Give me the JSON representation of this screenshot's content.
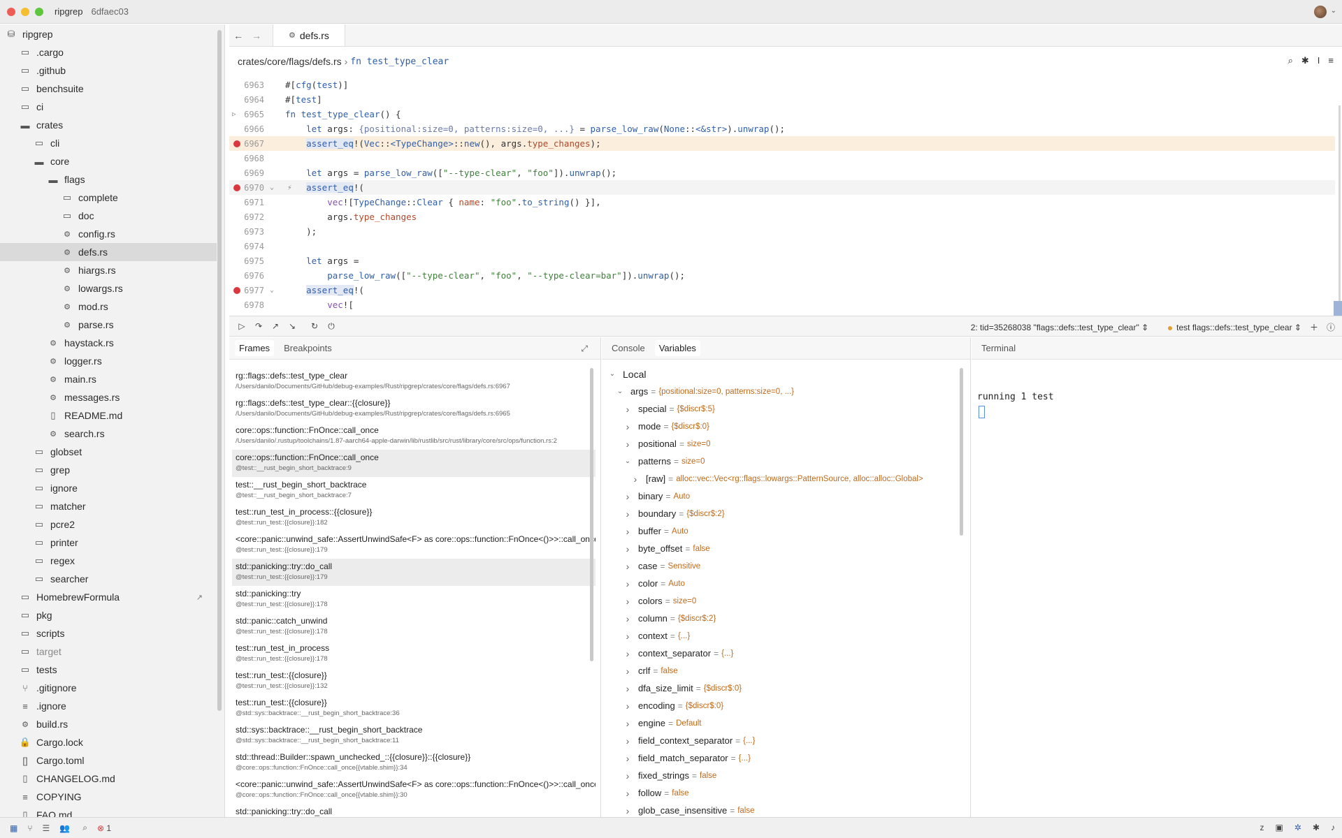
{
  "window": {
    "project": "ripgrep",
    "commit": "6dfaec03"
  },
  "colors": {
    "accent": "#2f5ea8",
    "breakpoint": "#d9393e",
    "value": "#c06a1c",
    "string": "#3f7f3a"
  },
  "sidebar": {
    "items": [
      {
        "label": "ripgrep",
        "icon": "repo-icon",
        "indent": 0
      },
      {
        "label": ".cargo",
        "icon": "folder-icon",
        "indent": 1
      },
      {
        "label": ".github",
        "icon": "folder-icon",
        "indent": 1
      },
      {
        "label": "benchsuite",
        "icon": "folder-icon",
        "indent": 1
      },
      {
        "label": "ci",
        "icon": "folder-icon",
        "indent": 1
      },
      {
        "label": "crates",
        "icon": "folder-open-icon",
        "indent": 1
      },
      {
        "label": "cli",
        "icon": "folder-icon",
        "indent": 2
      },
      {
        "label": "core",
        "icon": "folder-open-icon",
        "indent": 2
      },
      {
        "label": "flags",
        "icon": "folder-open-icon",
        "indent": 3
      },
      {
        "label": "complete",
        "icon": "folder-icon",
        "indent": 4
      },
      {
        "label": "doc",
        "icon": "folder-icon",
        "indent": 4
      },
      {
        "label": "config.rs",
        "icon": "rust-file-icon",
        "indent": 4
      },
      {
        "label": "defs.rs",
        "icon": "rust-file-icon",
        "indent": 4,
        "selected": true
      },
      {
        "label": "hiargs.rs",
        "icon": "rust-file-icon",
        "indent": 4
      },
      {
        "label": "lowargs.rs",
        "icon": "rust-file-icon",
        "indent": 4
      },
      {
        "label": "mod.rs",
        "icon": "rust-file-icon",
        "indent": 4
      },
      {
        "label": "parse.rs",
        "icon": "rust-file-icon",
        "indent": 4
      },
      {
        "label": "haystack.rs",
        "icon": "rust-file-icon",
        "indent": 3
      },
      {
        "label": "logger.rs",
        "icon": "rust-file-icon",
        "indent": 3
      },
      {
        "label": "main.rs",
        "icon": "rust-file-icon",
        "indent": 3
      },
      {
        "label": "messages.rs",
        "icon": "rust-file-icon",
        "indent": 3
      },
      {
        "label": "README.md",
        "icon": "book-icon",
        "indent": 3
      },
      {
        "label": "search.rs",
        "icon": "rust-file-icon",
        "indent": 3
      },
      {
        "label": "globset",
        "icon": "folder-icon",
        "indent": 2
      },
      {
        "label": "grep",
        "icon": "folder-icon",
        "indent": 2
      },
      {
        "label": "ignore",
        "icon": "folder-icon",
        "indent": 2
      },
      {
        "label": "matcher",
        "icon": "folder-icon",
        "indent": 2
      },
      {
        "label": "pcre2",
        "icon": "folder-icon",
        "indent": 2
      },
      {
        "label": "printer",
        "icon": "folder-icon",
        "indent": 2
      },
      {
        "label": "regex",
        "icon": "folder-icon",
        "indent": 2
      },
      {
        "label": "searcher",
        "icon": "folder-icon",
        "indent": 2
      },
      {
        "label": "HomebrewFormula",
        "icon": "folder-icon",
        "indent": 1,
        "ext": true
      },
      {
        "label": "pkg",
        "icon": "folder-icon",
        "indent": 1
      },
      {
        "label": "scripts",
        "icon": "folder-icon",
        "indent": 1
      },
      {
        "label": "target",
        "icon": "folder-icon",
        "indent": 1,
        "muted": true
      },
      {
        "label": "tests",
        "icon": "folder-icon",
        "indent": 1
      },
      {
        "label": ".gitignore",
        "icon": "git-icon",
        "indent": 1
      },
      {
        "label": ".ignore",
        "icon": "lines-icon",
        "indent": 1
      },
      {
        "label": "build.rs",
        "icon": "rust-file-icon",
        "indent": 1
      },
      {
        "label": "Cargo.lock",
        "icon": "lock-icon",
        "indent": 1
      },
      {
        "label": "Cargo.toml",
        "icon": "toml-icon",
        "indent": 1
      },
      {
        "label": "CHANGELOG.md",
        "icon": "file-icon",
        "indent": 1
      },
      {
        "label": "COPYING",
        "icon": "lines-icon",
        "indent": 1
      },
      {
        "label": "FAQ.md",
        "icon": "file-icon",
        "indent": 1
      }
    ]
  },
  "editor": {
    "tab": "defs.rs",
    "breadcrumb_path": "crates/core/flags/defs.rs",
    "breadcrumb_sep": "›",
    "breadcrumb_fn": "fn test_type_clear",
    "lines": [
      {
        "n": "6963",
        "html": "#[<span class='kw'>cfg</span>(<span class='kw'>test</span>)]"
      },
      {
        "n": "6964",
        "html": "#[<span class='kw'>test</span>]"
      },
      {
        "n": "6965",
        "html": "<span class='kw'>fn</span> <span class='kw'>test_type_clear</span>() {",
        "run": true
      },
      {
        "n": "6966",
        "html": "    <span class='kw'>let</span> args: <span class='inl'>{positional:size=0, patterns:size=0, ...}</span> = <span class='kw'>parse_low_raw</span>(<span class='kw'>None</span>::<span class='kw'>&lt;&amp;str&gt;</span>).<span class='kw'>unwrap</span>();"
      },
      {
        "n": "6967",
        "html": "    <span class='mc am'>assert_eq</span>!(<span class='kw'>Vec</span>::<span class='kw'>&lt;TypeChange&gt;</span>::<span class='kw'>new</span>(), args.<span class='fld'>type_changes</span>);",
        "bp": true,
        "hl": true
      },
      {
        "n": "6968",
        "html": ""
      },
      {
        "n": "6969",
        "html": "    <span class='kw'>let</span> args = <span class='kw'>parse_low_raw</span>([<span class='st'>\"--type-clear\"</span>, <span class='st'>\"foo\"</span>]).<span class='kw'>unwrap</span>();"
      },
      {
        "n": "6970",
        "html": "    <span class='mc am'>assert_eq</span>!(",
        "bp": true,
        "fold": true,
        "bolt": true,
        "hl2": true
      },
      {
        "n": "6971",
        "html": "        <span class='mc'>vec</span>![<span class='kw'>TypeChange</span>::<span class='kw'>Clear</span> { <span class='fld'>name</span>: <span class='st'>\"foo\"</span>.<span class='kw'>to_string</span>() }],"
      },
      {
        "n": "6972",
        "html": "        args.<span class='fld'>type_changes</span>"
      },
      {
        "n": "6973",
        "html": "    );"
      },
      {
        "n": "6974",
        "html": ""
      },
      {
        "n": "6975",
        "html": "    <span class='kw'>let</span> args ="
      },
      {
        "n": "6976",
        "html": "        <span class='kw'>parse_low_raw</span>([<span class='st'>\"--type-clear\"</span>, <span class='st'>\"foo\"</span>, <span class='st'>\"--type-clear=bar\"</span>]).<span class='kw'>unwrap</span>();"
      },
      {
        "n": "6977",
        "html": "    <span class='mc am'>assert_eq</span>!(",
        "bp": true,
        "fold": true
      },
      {
        "n": "6978",
        "html": "        <span class='mc'>vec</span>!["
      }
    ]
  },
  "debug": {
    "thread": "2: tid=35268038 \"flags::defs::test_type_clear\"",
    "session": "test flags::defs::test_type_clear"
  },
  "frames_panel": {
    "tabs": [
      "Frames",
      "Breakpoints"
    ],
    "frames": [
      {
        "name": "rg::flags::defs::test_type_clear",
        "path": "/Users/danilo/Documents/GitHub/debug-examples/Rust/ripgrep/crates/core/flags/defs.rs:6967"
      },
      {
        "name": "rg::flags::defs::test_type_clear::{{closure}}",
        "path": "/Users/danilo/Documents/GitHub/debug-examples/Rust/ripgrep/crates/core/flags/defs.rs:6965"
      },
      {
        "name": "core::ops::function::FnOnce::call_once",
        "path": "/Users/danilo/.rustup/toolchains/1.87-aarch64-apple-darwin/lib/rustlib/src/rust/library/core/src/ops/function.rs:2"
      },
      {
        "name": "core::ops::function::FnOnce::call_once",
        "path": "@test::__rust_begin_short_backtrace:9",
        "sel": true
      },
      {
        "name": "test::__rust_begin_short_backtrace",
        "path": "@test::__rust_begin_short_backtrace:7"
      },
      {
        "name": "test::run_test_in_process::{{closure}}",
        "path": "@test::run_test::{{closure}}:182"
      },
      {
        "name": "<core::panic::unwind_safe::AssertUnwindSafe<F> as core::ops::function::FnOnce<()>>::call_once",
        "path": "@test::run_test::{{closure}}:179"
      },
      {
        "name": "std::panicking::try::do_call",
        "path": "@test::run_test::{{closure}}:179",
        "sel": true
      },
      {
        "name": "std::panicking::try",
        "path": "@test::run_test::{{closure}}:178"
      },
      {
        "name": "std::panic::catch_unwind",
        "path": "@test::run_test::{{closure}}:178"
      },
      {
        "name": "test::run_test_in_process",
        "path": "@test::run_test::{{closure}}:178"
      },
      {
        "name": "test::run_test::{{closure}}",
        "path": "@test::run_test::{{closure}}:132"
      },
      {
        "name": "test::run_test::{{closure}}",
        "path": "@std::sys::backtrace::__rust_begin_short_backtrace:36"
      },
      {
        "name": "std::sys::backtrace::__rust_begin_short_backtrace",
        "path": "@std::sys::backtrace::__rust_begin_short_backtrace:11"
      },
      {
        "name": "std::thread::Builder::spawn_unchecked_::{{closure}}::{{closure}}",
        "path": "@core::ops::function::FnOnce::call_once{{vtable.shim}}:34"
      },
      {
        "name": "<core::panic::unwind_safe::AssertUnwindSafe<F> as core::ops::function::FnOnce<()>>::call_once",
        "path": "@core::ops::function::FnOnce::call_once{{vtable.shim}}:30"
      },
      {
        "name": "std::panicking::try::do_call",
        "path": ""
      }
    ]
  },
  "vars_panel": {
    "tabs": [
      "Console",
      "Variables"
    ],
    "vars": [
      {
        "name": "Local",
        "value": "",
        "level": 0,
        "open": true
      },
      {
        "name": "args",
        "value": "{positional:size=0, patterns:size=0, ...}",
        "level": 1,
        "open": true
      },
      {
        "name": "special",
        "value": "{$discr$:5}",
        "level": 2
      },
      {
        "name": "mode",
        "value": "{$discr$:0}",
        "level": 2
      },
      {
        "name": "positional",
        "value": "size=0",
        "level": 2
      },
      {
        "name": "patterns",
        "value": "size=0",
        "level": 2,
        "open": true
      },
      {
        "name": "[raw]",
        "value": "alloc::vec::Vec<rg::flags::lowargs::PatternSource, alloc::alloc::Global>",
        "level": 3
      },
      {
        "name": "binary",
        "value": "Auto",
        "level": 2
      },
      {
        "name": "boundary",
        "value": "{$discr$:2}",
        "level": 2
      },
      {
        "name": "buffer",
        "value": "Auto",
        "level": 2
      },
      {
        "name": "byte_offset",
        "value": "false",
        "level": 2
      },
      {
        "name": "case",
        "value": "Sensitive",
        "level": 2
      },
      {
        "name": "color",
        "value": "Auto",
        "level": 2
      },
      {
        "name": "colors",
        "value": "size=0",
        "level": 2
      },
      {
        "name": "column",
        "value": "{$discr$:2}",
        "level": 2
      },
      {
        "name": "context",
        "value": "{...}",
        "level": 2
      },
      {
        "name": "context_separator",
        "value": "{...}",
        "level": 2
      },
      {
        "name": "crlf",
        "value": "false",
        "level": 2
      },
      {
        "name": "dfa_size_limit",
        "value": "{$discr$:0}",
        "level": 2
      },
      {
        "name": "encoding",
        "value": "{$discr$:0}",
        "level": 2
      },
      {
        "name": "engine",
        "value": "Default",
        "level": 2
      },
      {
        "name": "field_context_separator",
        "value": "{...}",
        "level": 2
      },
      {
        "name": "field_match_separator",
        "value": "{...}",
        "level": 2
      },
      {
        "name": "fixed_strings",
        "value": "false",
        "level": 2
      },
      {
        "name": "follow",
        "value": "false",
        "level": 2
      },
      {
        "name": "glob_case_insensitive",
        "value": "false",
        "level": 2
      }
    ]
  },
  "terminal": {
    "title": "Terminal",
    "output": "running 1 test"
  },
  "status": {
    "errors": "1"
  }
}
